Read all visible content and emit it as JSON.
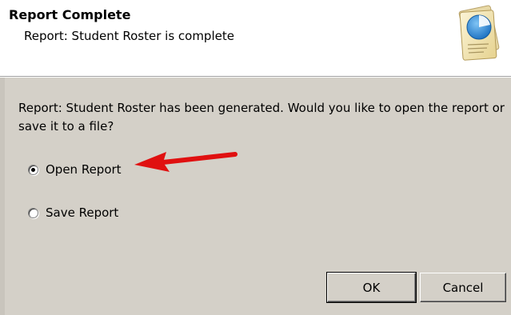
{
  "dialog": {
    "header": {
      "title": "Report Complete",
      "subtitle": "Report: Student Roster is complete",
      "icon": "report-document-icon"
    },
    "message": "Report: Student Roster has been generated. Would you like to open the report or save it to a file?",
    "options": [
      {
        "label": "Open Report",
        "selected": true
      },
      {
        "label": "Save Report",
        "selected": false
      }
    ],
    "annotation": {
      "icon": "red-arrow-icon",
      "color": "#e01010"
    },
    "buttons": {
      "ok": "OK",
      "cancel": "Cancel"
    },
    "colors": {
      "background": "#d4d0c8",
      "header_background": "#ffffff"
    }
  }
}
